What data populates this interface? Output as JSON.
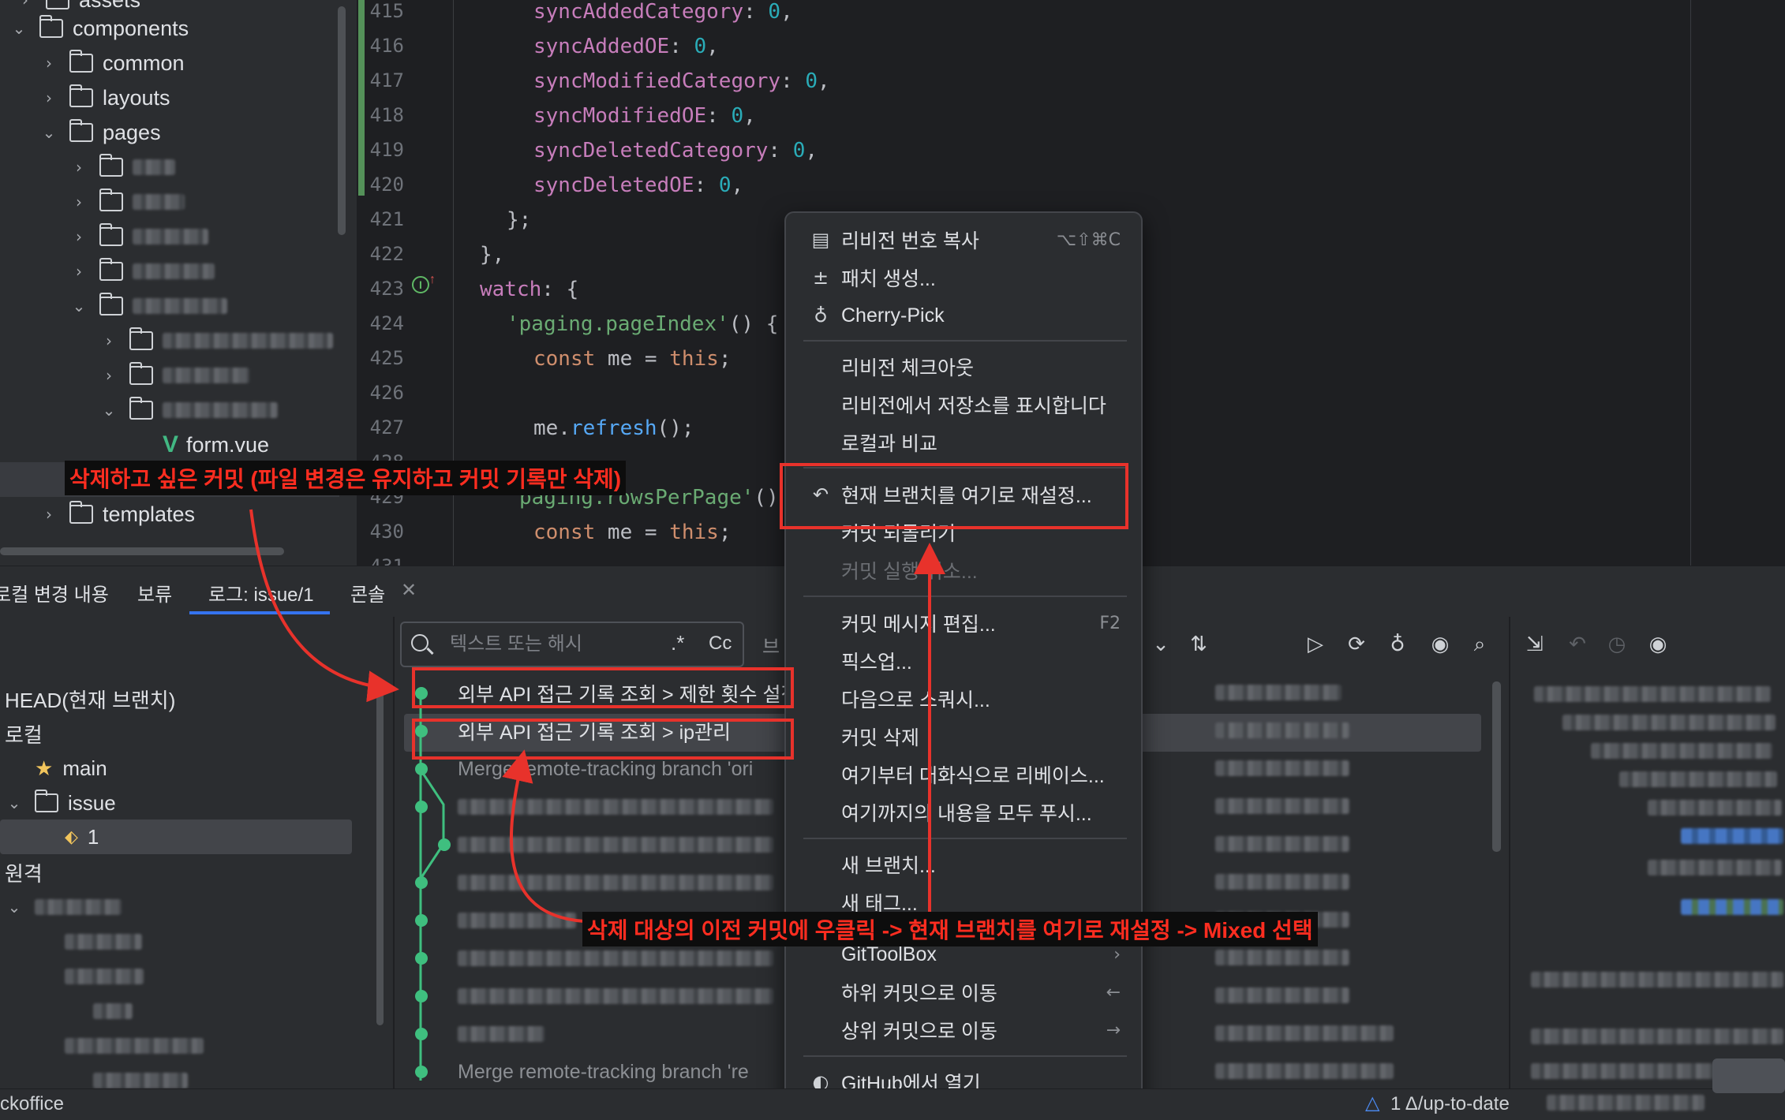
{
  "project_tree": {
    "items": [
      {
        "label": "assets"
      },
      {
        "label": "components"
      },
      {
        "label": "common"
      },
      {
        "label": "layouts"
      },
      {
        "label": "pages"
      },
      {
        "label": "form.vue"
      },
      {
        "label": "templates"
      }
    ]
  },
  "editor": {
    "lines": [
      {
        "num": "415"
      },
      {
        "num": "416"
      },
      {
        "num": "417"
      },
      {
        "num": "418"
      },
      {
        "num": "419"
      },
      {
        "num": "420"
      },
      {
        "num": "421"
      },
      {
        "num": "422"
      },
      {
        "num": "423"
      },
      {
        "num": "424"
      },
      {
        "num": "425"
      },
      {
        "num": "426"
      },
      {
        "num": "427"
      },
      {
        "num": "428"
      },
      {
        "num": "429"
      },
      {
        "num": "430"
      },
      {
        "num": "431"
      }
    ],
    "tokens": {
      "syncAddedCategory": "syncAddedCategory",
      "syncAddedOE": "syncAddedOE",
      "syncModifiedCategory": "syncModifiedCategory",
      "syncModifiedOE": "syncModifiedOE",
      "syncDeletedCategory": "syncDeletedCategory",
      "syncDeletedOE": "syncDeletedOE",
      "zero": "0",
      "colon": ": ",
      "comma": ",",
      "close_semicolon": "};",
      "close_comma": "},",
      "watch": "watch",
      "open_obj": ": {",
      "paging_index": "'paging.pageIndex'",
      "paren_open": "() {",
      "const": "const",
      "me_eq": " me = ",
      "this": "this",
      "semicolon": ";",
      "me_dot": "me.",
      "refresh": "refresh",
      "call_end": "();",
      "paging_rows": "paging.rowsPerPage'",
      "paren_rows": "()"
    }
  },
  "bottom_tabs": {
    "local_changes": "로컬 변경 내용",
    "shelf": "보류",
    "log": "로그: issue/1",
    "console": "콘솔",
    "close_glyph": "✕"
  },
  "branches": {
    "head": "HEAD(현재 브랜치)",
    "local": "로컬",
    "main": "main",
    "issue": "issue",
    "issue_1": "1",
    "remote": "원격"
  },
  "log_search": {
    "placeholder": "텍스트 또는 해시",
    "regex": ".*",
    "case": "Cc",
    "branch_filter": "브"
  },
  "commits": [
    {
      "subject": "외부 API 접근 기록 조회 > 제한 횟수 설정"
    },
    {
      "subject": "외부 API 접근 기록 조회 > ip관리"
    },
    {
      "subject": "Merge remote-tracking branch 'ori"
    },
    {
      "subject": "Merge remote-tracking branch 're"
    }
  ],
  "context_menu": {
    "copy_revision": {
      "label": "리비전 번호 복사",
      "shortcut": "⌥⇧⌘C"
    },
    "create_patch": {
      "label": "패치 생성..."
    },
    "cherry_pick": {
      "label": "Cherry-Pick"
    },
    "checkout_revision": {
      "label": "리비전 체크아웃"
    },
    "show_repo_at_revision": {
      "label": "리비전에서 저장소를 표시합니다"
    },
    "compare_with_local": {
      "label": "로컬과 비교"
    },
    "reset_branch_here": {
      "label": "현재 브랜치를 여기로 재설정..."
    },
    "revert_commit": {
      "label": "커밋 되돌리기"
    },
    "undo_commit": {
      "label": "커밋 실행 취소..."
    },
    "edit_message": {
      "label": "커밋 메시지 편집...",
      "shortcut": "F2"
    },
    "fixup": {
      "label": "픽스업..."
    },
    "squash_into": {
      "label": "다음으로 스쿼시..."
    },
    "drop_commit": {
      "label": "커밋 삭제"
    },
    "interactive_rebase": {
      "label": "여기부터 대화식으로 리베이스..."
    },
    "push_all_up_to_here": {
      "label": "여기까지의 내용을 모두 푸시..."
    },
    "new_branch": {
      "label": "새 브랜치..."
    },
    "new_tag": {
      "label": "새 태그..."
    },
    "gittoolbox": {
      "label": "GitToolBox"
    },
    "go_to_child": {
      "label": "하위 커밋으로 이동"
    },
    "go_to_parent": {
      "label": "상위 커밋으로 이동"
    },
    "open_on_github": {
      "label": "GitHub에서 열기"
    }
  },
  "annotations": {
    "commit_to_delete": "삭제하고 싶은 커밋 (파일 변경은 유지하고 커밋 기록만 삭제)",
    "instruction": "삭제 대상의 이전 커밋에 우클릭 -> 현재 브랜치를 여기로 재설정 -> Mixed 선택"
  },
  "status_bar": {
    "project": "ckoffice",
    "git_status": "1 Δ/up-to-date"
  },
  "colors": {
    "annotation_red": "#e8322b",
    "graph_green": "#3fbf7f",
    "accent_blue": "#3574f0"
  }
}
